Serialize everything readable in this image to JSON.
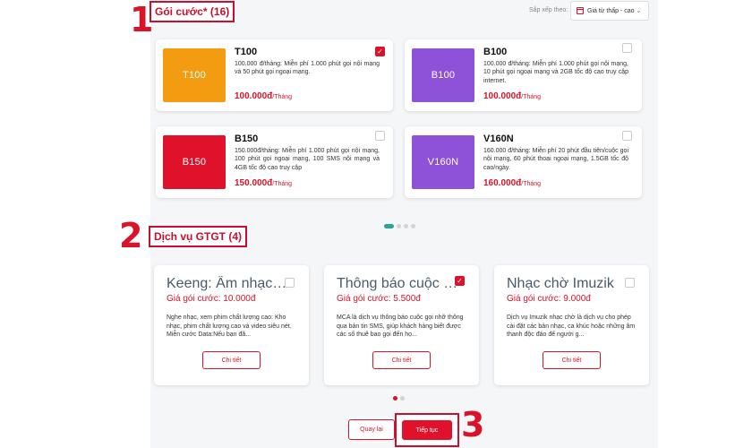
{
  "annotations": {
    "step1": "1",
    "step2": "2",
    "step3": "3"
  },
  "packages": {
    "title": "Gói cước* (16)",
    "sort_label": "Sắp xếp theo:",
    "sort_value": "Giá từ thấp - cao",
    "items": [
      {
        "name": "T100",
        "thumb_label": "T100",
        "thumb_color": "#f39c12",
        "desc": "100.000 đ/tháng: Miễn phí 1.000 phút gọi nội mạng và 50 phút gọi ngoại mạng.",
        "price": "100.000đ",
        "unit": "/Tháng",
        "checked": true
      },
      {
        "name": "B100",
        "thumb_label": "B100",
        "thumb_color": "#8e52d9",
        "desc": "100.000 đ/tháng: Miễn phí 1.000 phút gọi nội mạng, 10 phút gọi ngoại mạng và 2GB tốc độ cao truy cập internet.",
        "price": "100.000đ",
        "unit": "/Tháng",
        "checked": false
      },
      {
        "name": "B150",
        "thumb_label": "B150",
        "thumb_color": "#e0112b",
        "desc": "150.000đ/tháng: Miễn phí 1.000 phút gọi nội mạng, 100 phút gọi ngoại mạng, 100 SMS nội mạng và 4GB tốc độ cao truy cập",
        "price": "150.000đ",
        "unit": "/Tháng",
        "checked": false
      },
      {
        "name": "V160N",
        "thumb_label": "V160N",
        "thumb_color": "#8e52d9",
        "desc": "160.000 đ/tháng: Miễn phí 20 phút đầu tiên/cuộc gọi nội mạng, 60 phút thoại ngoại mạng, 1.5GB tốc độ cao/ngày.",
        "price": "160.000đ",
        "unit": "/Tháng",
        "checked": false
      }
    ]
  },
  "services": {
    "title": "Dịch vụ GTGT (4)",
    "items": [
      {
        "name": "Keeng: Âm nhạc, phim, video",
        "price": "Giá gói cước: 10.000đ",
        "desc": "Nghe nhạc, xem phim chất lượng cao: Kho nhạc, phim chất lượng cao và video siêu nét. Miễn cước Data:Nếu bạn đã...",
        "detail": "Chi tiết",
        "checked": false
      },
      {
        "name": "Thông báo cuộc gọi nhỡ",
        "price": "Giá gói cước: 5.500đ",
        "desc": "MCA là dịch vụ thông báo cuộc gọi nhỡ thông qua bản tin SMS, giúp khách hàng biết được các số thuê bao gọi đến họ...",
        "detail": "Chi tiết",
        "checked": true
      },
      {
        "name": "Nhạc chờ Imuzik",
        "price": "Giá gói cước: 9.000đ",
        "desc": "Dịch vụ Imuzik nhạc chờ là dịch vụ cho phép cài đặt các bản nhạc, ca khúc hoặc những âm thanh độc đáo để người g...",
        "detail": "Chi tiết",
        "checked": false
      }
    ]
  },
  "buttons": {
    "back": "Quay lại",
    "next": "Tiếp tục"
  },
  "colors": {
    "brand_red": "#d8132a",
    "carousel_active": "#2aa39a"
  }
}
